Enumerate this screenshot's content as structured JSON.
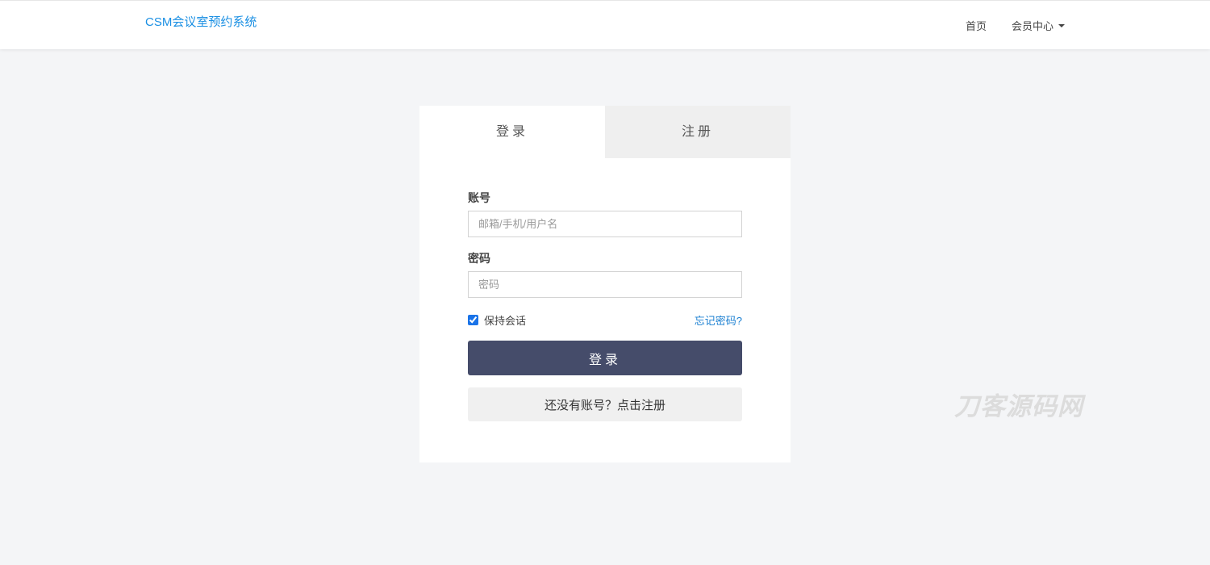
{
  "navbar": {
    "brand": "CSM会议室预约系统",
    "links": {
      "home": "首页",
      "member_center": "会员中心"
    },
    "member_dropdown_icon": "caret-down-icon"
  },
  "card": {
    "tabs": [
      {
        "label": "登录",
        "active": true
      },
      {
        "label": "注册",
        "active": false
      }
    ],
    "account": {
      "label": "账号",
      "placeholder": "邮箱/手机/用户名",
      "value": ""
    },
    "password": {
      "label": "密码",
      "placeholder": "密码",
      "value": ""
    },
    "remember": {
      "label": "保持会话",
      "checked": true
    },
    "forgot_link": "忘记密码?",
    "login_button": "登录",
    "register_button": "还没有账号？点击注册"
  },
  "watermark": "刀客源码网",
  "colors": {
    "brand": "#1a8fe3",
    "primary_button": "#454c6a",
    "link": "#1a7fd1",
    "page_background": "#f4f5f7"
  }
}
